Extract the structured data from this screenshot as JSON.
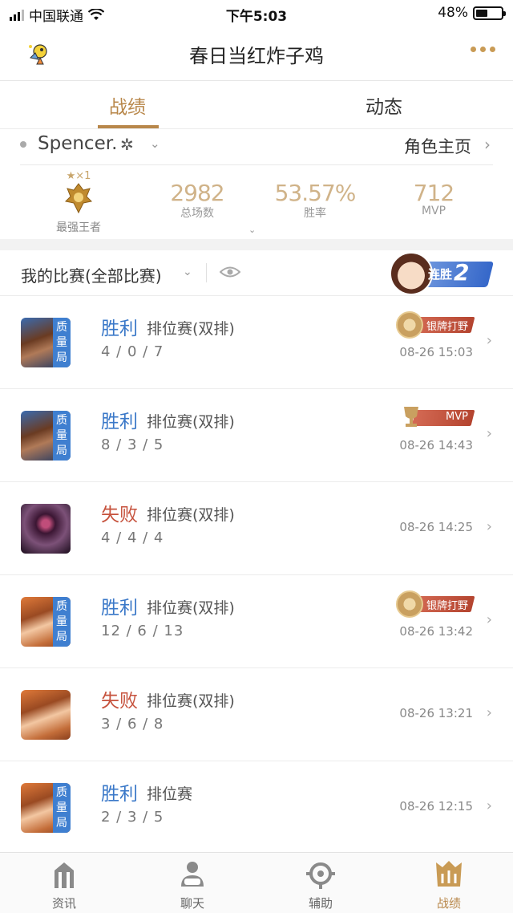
{
  "status_bar": {
    "carrier": "中国联通",
    "time": "下午5:03",
    "battery": "48%",
    "battery_level": 0.48
  },
  "header": {
    "title": "春日当红炸子鸡"
  },
  "tabs": [
    {
      "label": "战绩",
      "active": true
    },
    {
      "label": "动态",
      "active": false
    }
  ],
  "profile": {
    "name": "Spencer.",
    "role_page": "角色主页"
  },
  "rank": {
    "stars": "★×1",
    "label": "最强王者"
  },
  "stats": [
    {
      "value": "2982",
      "label": "总场数"
    },
    {
      "value": "53.57%",
      "label": "胜率"
    },
    {
      "value": "712",
      "label": "MVP"
    }
  ],
  "my_games": {
    "label": "我的比赛(全部比赛)"
  },
  "streak": {
    "label": "连胜",
    "count": "2"
  },
  "matches": [
    {
      "result": "胜利",
      "outcome": "win",
      "mode": "排位赛(双排)",
      "kda": "4 / 0 / 7",
      "time": "08-26 15:03",
      "quality": "质量局",
      "badge": "银牌打野",
      "hero": "a"
    },
    {
      "result": "胜利",
      "outcome": "win",
      "mode": "排位赛(双排)",
      "kda": "8 / 3 / 5",
      "time": "08-26 14:43",
      "quality": "质量局",
      "badge": "MVP",
      "hero": "a"
    },
    {
      "result": "失败",
      "outcome": "lose",
      "mode": "排位赛(双排)",
      "kda": "4 / 4 / 4",
      "time": "08-26 14:25",
      "quality": "",
      "badge": "",
      "hero": "b"
    },
    {
      "result": "胜利",
      "outcome": "win",
      "mode": "排位赛(双排)",
      "kda": "12 / 6 / 13",
      "time": "08-26 13:42",
      "quality": "质量局",
      "badge": "银牌打野",
      "hero": "c"
    },
    {
      "result": "失败",
      "outcome": "lose",
      "mode": "排位赛(双排)",
      "kda": "3 / 6 / 8",
      "time": "08-26 13:21",
      "quality": "",
      "badge": "",
      "hero": "c"
    },
    {
      "result": "胜利",
      "outcome": "win",
      "mode": "排位赛",
      "kda": "2 / 3 / 5",
      "time": "08-26 12:15",
      "quality": "质量局",
      "badge": "",
      "hero": "c"
    }
  ],
  "bottom_nav": [
    {
      "label": "资讯",
      "icon": "news-icon",
      "active": false
    },
    {
      "label": "聊天",
      "icon": "chat-icon",
      "active": false
    },
    {
      "label": "辅助",
      "icon": "assist-icon",
      "active": false
    },
    {
      "label": "战绩",
      "icon": "record-icon",
      "active": true
    }
  ],
  "colors": {
    "accent": "#b8874a",
    "win": "#3a78c8",
    "lose": "#c6523d",
    "quality_tag": "#3f7fd0"
  }
}
